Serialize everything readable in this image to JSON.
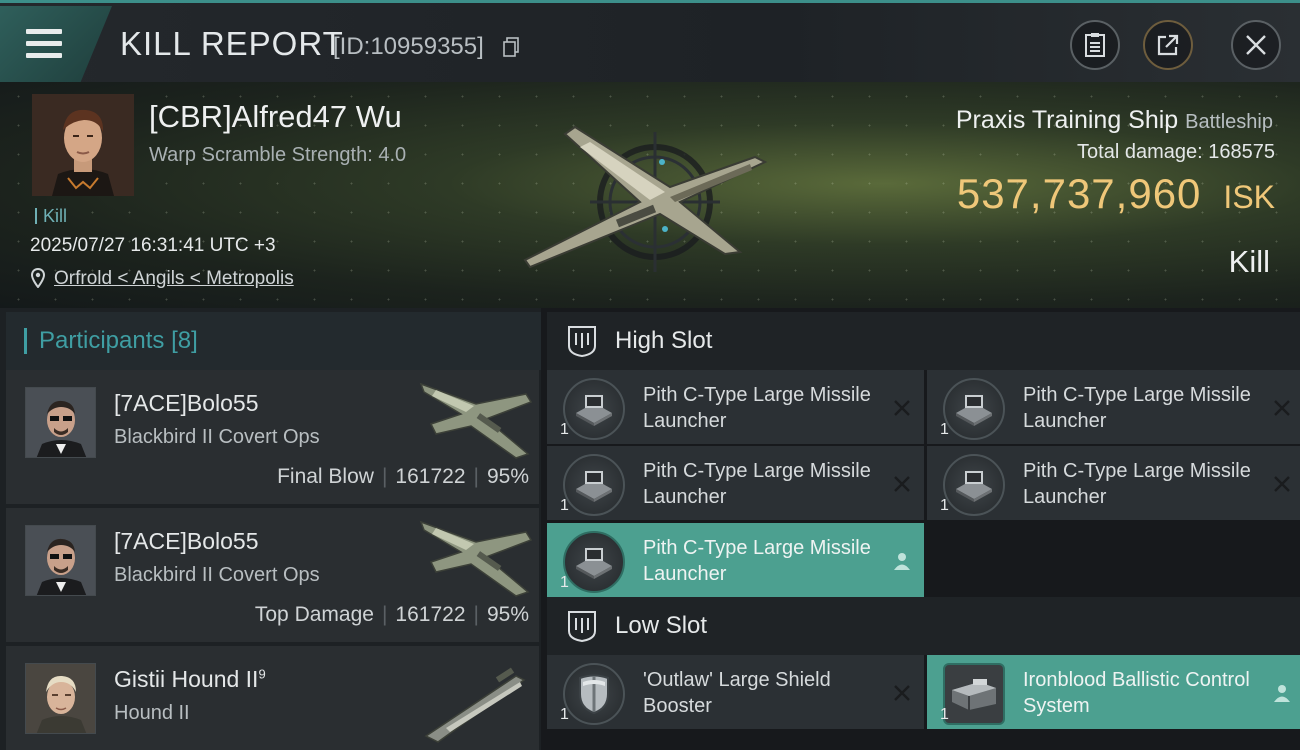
{
  "header": {
    "title": "KILL REPORT",
    "report_id": "[ID:10959355]"
  },
  "victim": {
    "name": "[CBR]Alfred47 Wu",
    "warp_scramble": "Warp Scramble Strength: 4.0",
    "tag": "Kill",
    "datetime": "2025/07/27 16:31:41 UTC +3",
    "location": "Orfrold < Angils < Metropolis",
    "ship_name": "Praxis Training Ship",
    "ship_class": "Battleship",
    "total_damage_label": "Total damage:",
    "total_damage": "168575",
    "isk_value": "537,737,960",
    "isk_unit": "ISK",
    "result": "Kill"
  },
  "participants": {
    "label": "Participants",
    "count": "[8]",
    "rows": [
      {
        "name": "[7ACE]Bolo55",
        "ship": "Blackbird II Covert Ops",
        "role": "Final Blow",
        "damage": "161722",
        "percent": "95%"
      },
      {
        "name": "[7ACE]Bolo55",
        "ship": "Blackbird II Covert Ops",
        "role": "Top Damage",
        "damage": "161722",
        "percent": "95%"
      },
      {
        "name": "Gistii Hound II",
        "name_sup": "9",
        "ship": "Hound II",
        "role": "",
        "damage": "",
        "percent": ""
      }
    ]
  },
  "slots": {
    "high": {
      "label": "High Slot",
      "modules": [
        {
          "name": "Pith C-Type Large Missile Launcher",
          "qty": "1",
          "status": "destroyed"
        },
        {
          "name": "Pith C-Type Large Missile Launcher",
          "qty": "1",
          "status": "destroyed"
        },
        {
          "name": "Pith C-Type Large Missile Launcher",
          "qty": "1",
          "status": "destroyed"
        },
        {
          "name": "Pith C-Type Large Missile Launcher",
          "qty": "1",
          "status": "destroyed"
        },
        {
          "name": "Pith C-Type Large Missile Launcher",
          "qty": "1",
          "status": "dropped"
        }
      ]
    },
    "low": {
      "label": "Low Slot",
      "modules": [
        {
          "name": "'Outlaw' Large Shield Booster",
          "qty": "1",
          "status": "destroyed"
        },
        {
          "name": "Ironblood Ballistic Control System",
          "qty": "1",
          "status": "dropped"
        }
      ]
    }
  },
  "colors": {
    "accent": "#3f9ea3",
    "isk": "#efc779",
    "dropped": "#4ca090"
  },
  "icons": [
    "menu-icon",
    "copy-icon",
    "clipboard-icon",
    "share-icon",
    "close-icon",
    "location-pin-icon",
    "slot-shield-icon",
    "destroyed-x-icon",
    "dropped-person-icon"
  ]
}
